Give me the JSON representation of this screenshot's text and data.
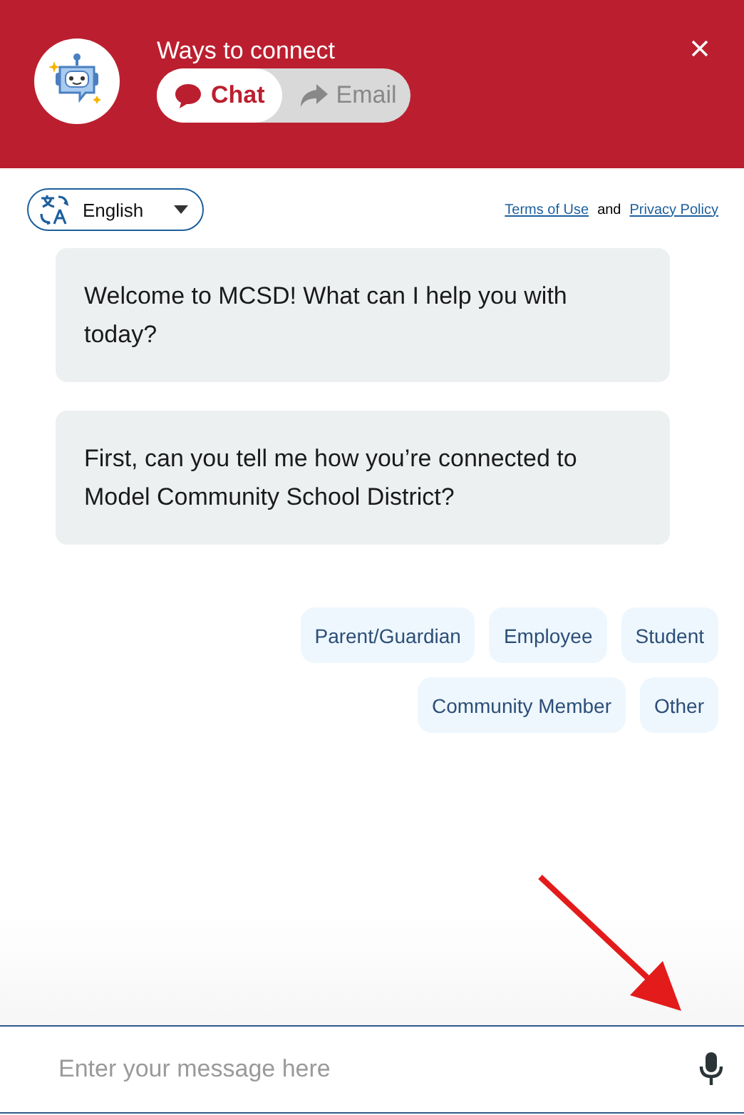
{
  "header": {
    "title": "Ways to connect",
    "tabs": [
      {
        "label": "Chat",
        "kind": "chat",
        "selected": true
      },
      {
        "label": "Email",
        "kind": "email",
        "selected": false
      }
    ]
  },
  "language": {
    "value": "English"
  },
  "legal": {
    "terms": "Terms of Use",
    "and": "and",
    "privacy": "Privacy Policy"
  },
  "messages": [
    "Welcome to MCSD! What can I help you with today?",
    "First, can you tell me how you’re connected to Model Community School District?"
  ],
  "options": [
    [
      "Parent/Guardian",
      "Employee",
      "Student"
    ],
    [
      "Community Member",
      "Other"
    ]
  ],
  "input": {
    "placeholder": "Enter your message here"
  }
}
